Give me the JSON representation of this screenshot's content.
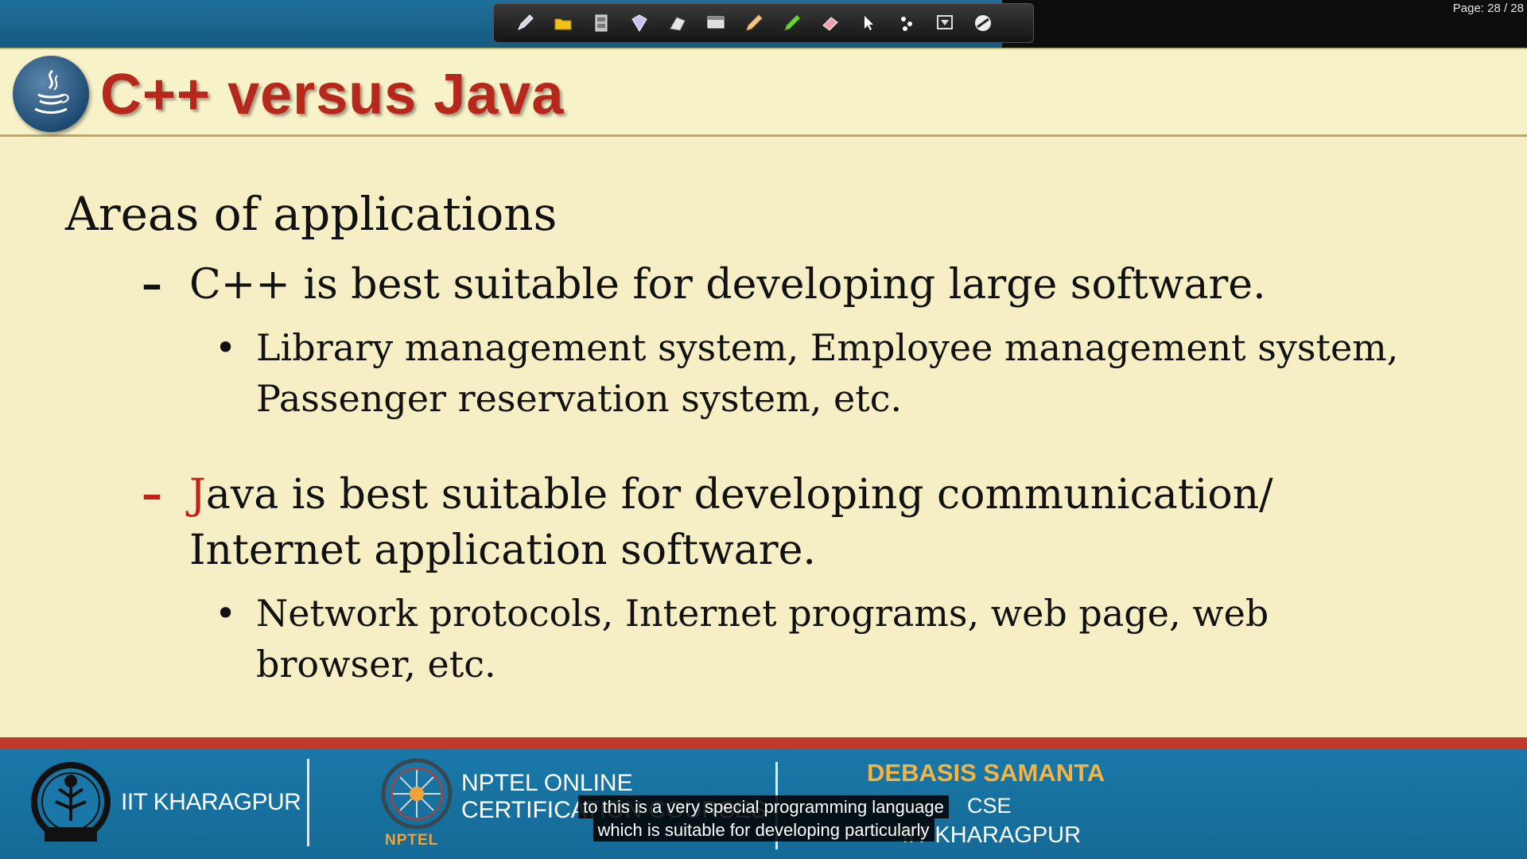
{
  "viewer": {
    "page_indicator": "Page: 28 / 28",
    "tools": [
      "pen-icon",
      "folder-icon",
      "film-icon",
      "marker-icon",
      "stamp-icon",
      "board-icon",
      "pencil-icon",
      "highlighter-icon",
      "eraser-icon",
      "pointer-icon",
      "laser-icon",
      "screen-icon",
      "clear-icon"
    ]
  },
  "slide": {
    "title": "C++ versus Java",
    "heading": "Areas of applications",
    "points": [
      {
        "dash": "–",
        "text": "C++ is best suitable for developing large software.",
        "sub": "Library management system, Employee management system, Passenger reservation system, etc."
      },
      {
        "dash": "–",
        "first_letter": "J",
        "text_rest": "ava is best suitable for developing communication/ Internet application software.",
        "sub": "Network protocols, Internet programs, web page, web browser, etc."
      }
    ],
    "bullet": "•"
  },
  "footer": {
    "institute": "IIT KHARAGPUR",
    "nptel_line1": "NPTEL ONLINE",
    "nptel_line2": "CERTIFICATION COURSES",
    "nptel_small": "NPTEL",
    "professor": "DEBASIS SAMANTA",
    "department": "CSE",
    "institute_short": "IIT KHARAGPUR"
  },
  "captions": {
    "line1": "to this is a very special programming language",
    "line2": "which is suitable for developing particularly"
  },
  "colors": {
    "title": "#b6271c",
    "accent_red": "#c81e16",
    "footer_blue": "#1a78a8",
    "footer_red": "#c0392b",
    "slide_bg": "#f6efc5",
    "professor_gold": "#f4b43f"
  }
}
